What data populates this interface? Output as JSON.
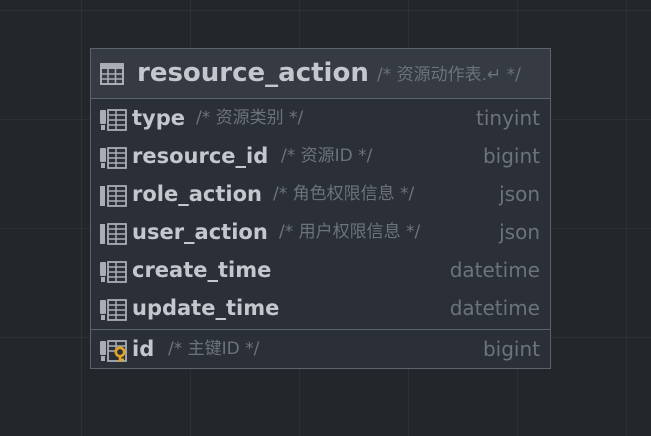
{
  "entity": {
    "name": "resource_action",
    "comment": "/* 资源动作表.↵ */",
    "table_icon": "table-icon",
    "columns": [
      {
        "name": "type",
        "comment": "/* 资源类别 */",
        "type": "tinyint",
        "icon": "column-icon"
      },
      {
        "name": "resource_id",
        "comment": "/* 资源ID */",
        "type": "bigint",
        "icon": "column-icon"
      },
      {
        "name": "role_action",
        "comment": "/* 角色权限信息 */",
        "type": "json",
        "icon": "column-json-icon"
      },
      {
        "name": "user_action",
        "comment": "/* 用户权限信息 */",
        "type": "json",
        "icon": "column-json-icon"
      },
      {
        "name": "create_time",
        "comment": "",
        "type": "datetime",
        "icon": "column-icon"
      },
      {
        "name": "update_time",
        "comment": "",
        "type": "datetime",
        "icon": "column-icon"
      }
    ],
    "key_columns": [
      {
        "name": "id",
        "comment": "/* 主键ID */",
        "type": "bigint",
        "icon": "primary-key-column-icon"
      }
    ],
    "colors": {
      "background": "#23262b",
      "header": "#353a43",
      "body": "#2b2f37",
      "border": "#5d636b",
      "name_text": "#c4c8ce",
      "muted_text": "#6d737c",
      "key_gold": "#e0a528"
    }
  }
}
